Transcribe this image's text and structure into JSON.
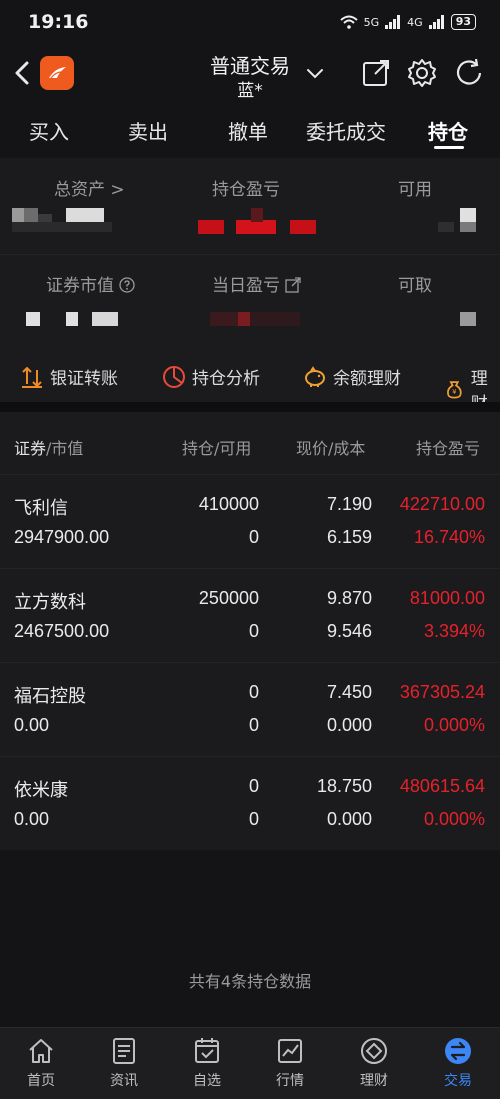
{
  "status": {
    "time": "19:16",
    "net1": "5G",
    "net2": "4G",
    "battery": "93"
  },
  "header": {
    "title": "普通交易",
    "subtitle": "蓝*"
  },
  "tabs": [
    {
      "label": "买入"
    },
    {
      "label": "卖出"
    },
    {
      "label": "撤单"
    },
    {
      "label": "委托成交"
    },
    {
      "label": "持仓"
    }
  ],
  "summary": {
    "total_assets": "总资产 >",
    "position_pnl": "持仓盈亏",
    "available": "可用",
    "market_value": "证券市值",
    "daily_pnl": "当日盈亏",
    "withdrawable": "可取"
  },
  "quick_actions": [
    {
      "label": "银证转账",
      "icon": "transfer-icon"
    },
    {
      "label": "持仓分析",
      "icon": "pie-chart-icon"
    },
    {
      "label": "余额理财",
      "icon": "piggy-bank-icon"
    },
    {
      "label": "理财",
      "icon": "money-bag-icon"
    }
  ],
  "table": {
    "headers": {
      "sec": "证券",
      "sec_rest": "/市值",
      "hold": "持仓/可用",
      "price": "现价/成本",
      "pnl": "持仓盈亏"
    },
    "rows": [
      {
        "name": "飞利信",
        "market_value": "2947900.00",
        "position": "410000",
        "available": "0",
        "price": "7.190",
        "cost": "6.159",
        "pnl": "422710.00",
        "pnl_pct": "16.740%"
      },
      {
        "name": "立方数科",
        "market_value": "2467500.00",
        "position": "250000",
        "available": "0",
        "price": "9.870",
        "cost": "9.546",
        "pnl": "81000.00",
        "pnl_pct": "3.394%"
      },
      {
        "name": "福石控股",
        "market_value": "0.00",
        "position": "0",
        "available": "0",
        "price": "7.450",
        "cost": "0.000",
        "pnl": "367305.24",
        "pnl_pct": "0.000%"
      },
      {
        "name": "依米康",
        "market_value": "0.00",
        "position": "0",
        "available": "0",
        "price": "18.750",
        "cost": "0.000",
        "pnl": "480615.64",
        "pnl_pct": "0.000%"
      }
    ]
  },
  "footer_note": "共有4条持仓数据",
  "bottom_nav": [
    {
      "label": "首页",
      "icon": "home-icon"
    },
    {
      "label": "资讯",
      "icon": "news-icon"
    },
    {
      "label": "自选",
      "icon": "watchlist-icon"
    },
    {
      "label": "行情",
      "icon": "market-icon"
    },
    {
      "label": "理财",
      "icon": "wealth-icon"
    },
    {
      "label": "交易",
      "icon": "trade-icon"
    }
  ],
  "colors": {
    "accent": "#3d86f5",
    "loss_red": "#e6212c",
    "logo": "#ef5a1f"
  }
}
